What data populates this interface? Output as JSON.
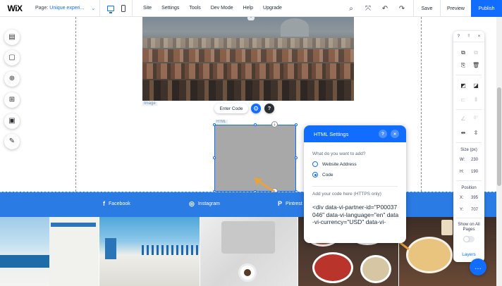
{
  "topbar": {
    "logo": "WiX",
    "page_label": "Page:",
    "page_value": "Unique experi...",
    "menu": [
      "Site",
      "Settings",
      "Tools",
      "Dev Mode",
      "Help",
      "Upgrade"
    ],
    "save": "Save",
    "preview": "Preview",
    "publish": "Publish"
  },
  "canvas": {
    "image_tag": "Image",
    "html_tag": "HTML",
    "enter_code": "Enter Code",
    "social": [
      {
        "icon": "f",
        "label": "Facebook"
      },
      {
        "icon": "◎",
        "label": "Instagram"
      },
      {
        "icon": "P",
        "label": "Pintrest"
      }
    ]
  },
  "html_settings": {
    "title": "HTML Settings",
    "question": "What do you want to add?",
    "option_website": "Website Address",
    "option_code": "Code",
    "selected": "Code",
    "code_label": "Add your code here (HTTPS only)",
    "code_value": "<div data-vi-partner-id=\"P00037046\" data-vi-language=\"en\" data-vi-currency=\"USD\" data-vi-"
  },
  "right_panel": {
    "size_label": "Size (px)",
    "w_label": "W:",
    "w_value": "230",
    "h_label": "H:",
    "h_value": "190",
    "angle_value": "0°",
    "position_label": "Position",
    "x_label": "X:",
    "x_value": "395",
    "y_label": "Y:",
    "y_value": "707",
    "show_all_pages": "Show on All Pages",
    "layers": "Layers"
  },
  "colors": {
    "accent": "#116dff",
    "social_band": "#2b7be5",
    "arrow": "#e8a33d"
  }
}
